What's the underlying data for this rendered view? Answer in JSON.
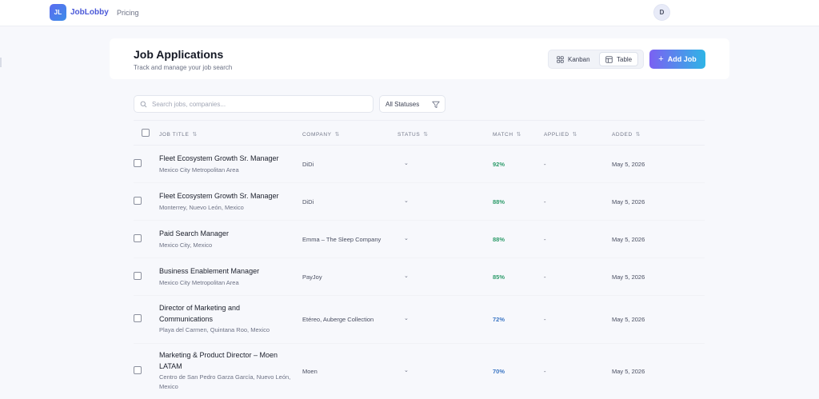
{
  "nav": {
    "logo_text": "JL",
    "brand": "JobLobby",
    "links": [
      "Pricing"
    ],
    "avatar_initial": "D"
  },
  "header": {
    "title": "Job Applications",
    "subtitle": "Track and manage your job search",
    "views": [
      "Kanban",
      "Table"
    ],
    "active_view": "Table",
    "add_job_label": "Add Job"
  },
  "filters": {
    "search_placeholder": "Search jobs, companies...",
    "status_label": "All Statuses"
  },
  "table": {
    "columns": [
      "JOB TITLE",
      "COMPANY",
      "STATUS",
      "MATCH",
      "APPLIED",
      "ADDED"
    ],
    "sort_glyph": "⇅",
    "status_glyph": "⌄",
    "rows": [
      {
        "title": "Fleet Ecosystem Growth Sr. Manager",
        "location": "Mexico City Metropolitan Area",
        "company": "DiDi",
        "match": "92%",
        "applied": "-",
        "added": "May 5, 2026"
      },
      {
        "title": "Fleet Ecosystem Growth Sr. Manager",
        "location": "Monterrey, Nuevo León, Mexico",
        "company": "DiDi",
        "match": "88%",
        "applied": "-",
        "added": "May 5, 2026"
      },
      {
        "title": "Paid Search Manager",
        "location": "Mexico City, Mexico",
        "company": "Emma – The Sleep Company",
        "match": "88%",
        "applied": "-",
        "added": "May 5, 2026"
      },
      {
        "title": "Business Enablement Manager",
        "location": "Mexico City Metropolitan Area",
        "company": "PayJoy",
        "match": "85%",
        "applied": "-",
        "added": "May 5, 2026"
      },
      {
        "title": "Director of Marketing and Communications",
        "location": "Playa del Carmen, Quintana Roo, Mexico",
        "company": "Etéreo, Auberge Collection",
        "match": "72%",
        "applied": "-",
        "added": "May 5, 2026"
      },
      {
        "title": "Marketing & Product Director – Moen LATAM",
        "location": "Centro de San Pedro Garza García, Nuevo León, Mexico",
        "company": "Moen",
        "match": "70%",
        "applied": "-",
        "added": "May 5, 2026"
      }
    ]
  },
  "colors": {
    "brand": "#4b59d8",
    "match_high": "#2e9c6b",
    "match_mid": "#3b76c4",
    "add_job_gradient_start": "#7b61f2",
    "add_job_gradient_end": "#2fb4e6"
  }
}
